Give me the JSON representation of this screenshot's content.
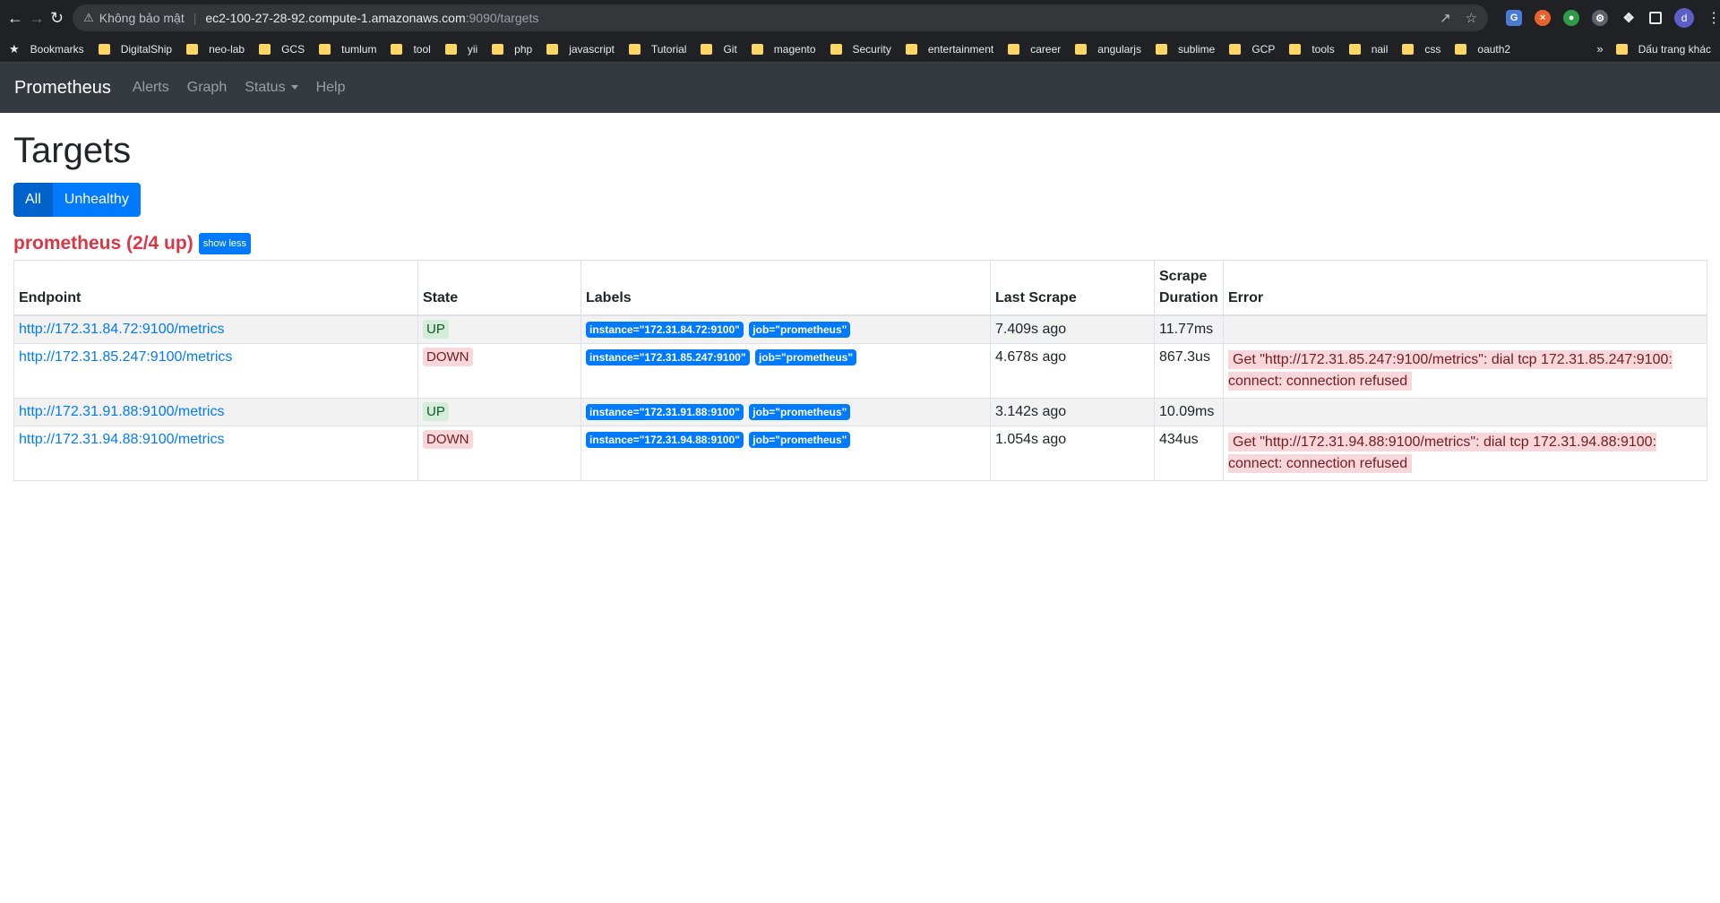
{
  "browser": {
    "security_label": "Không bảo mật",
    "url_host": "ec2-100-27-28-92.compute-1.amazonaws.com",
    "url_path": ":9090/targets",
    "avatar_letter": "d",
    "bookmarks_label": "Bookmarks",
    "bookmark_folders": [
      "DigitalShip",
      "neo-lab",
      "GCS",
      "tumlum",
      "tool",
      "yii",
      "php",
      "javascript",
      "Tutorial",
      "Git",
      "magento",
      "Security",
      "entertainment",
      "career",
      "angularjs",
      "sublime",
      "GCP",
      "tools",
      "nail",
      "css",
      "oauth2"
    ],
    "more_label": "»",
    "other_bookmarks": "Dấu trang khác"
  },
  "navbar": {
    "brand": "Prometheus",
    "links": [
      "Alerts",
      "Graph",
      "Status",
      "Help"
    ]
  },
  "page": {
    "title": "Targets",
    "filter_all": "All",
    "filter_unhealthy": "Unhealthy",
    "job_title": "prometheus (2/4 up)",
    "toggle_label": "show less"
  },
  "table": {
    "headers": {
      "endpoint": "Endpoint",
      "state": "State",
      "labels": "Labels",
      "last_scrape": "Last Scrape",
      "scrape_duration_line1": "Scrape",
      "scrape_duration_line2": "Duration",
      "error": "Error"
    },
    "rows": [
      {
        "endpoint": "http://172.31.84.72:9100/metrics",
        "state": "UP",
        "label_instance": "instance=\"172.31.84.72:9100\"",
        "label_job": "job=\"prometheus\"",
        "last_scrape": "7.409s ago",
        "duration": "11.77ms",
        "error": ""
      },
      {
        "endpoint": "http://172.31.85.247:9100/metrics",
        "state": "DOWN",
        "label_instance": "instance=\"172.31.85.247:9100\"",
        "label_job": "job=\"prometheus\"",
        "last_scrape": "4.678s ago",
        "duration": "867.3us",
        "error": "Get \"http://172.31.85.247:9100/metrics\": dial tcp 172.31.85.247:9100: connect: connection refused"
      },
      {
        "endpoint": "http://172.31.91.88:9100/metrics",
        "state": "UP",
        "label_instance": "instance=\"172.31.91.88:9100\"",
        "label_job": "job=\"prometheus\"",
        "last_scrape": "3.142s ago",
        "duration": "10.09ms",
        "error": ""
      },
      {
        "endpoint": "http://172.31.94.88:9100/metrics",
        "state": "DOWN",
        "label_instance": "instance=\"172.31.94.88:9100\"",
        "label_job": "job=\"prometheus\"",
        "last_scrape": "1.054s ago",
        "duration": "434us",
        "error": "Get \"http://172.31.94.88:9100/metrics\": dial tcp 172.31.94.88:9100: connect: connection refused"
      }
    ]
  }
}
